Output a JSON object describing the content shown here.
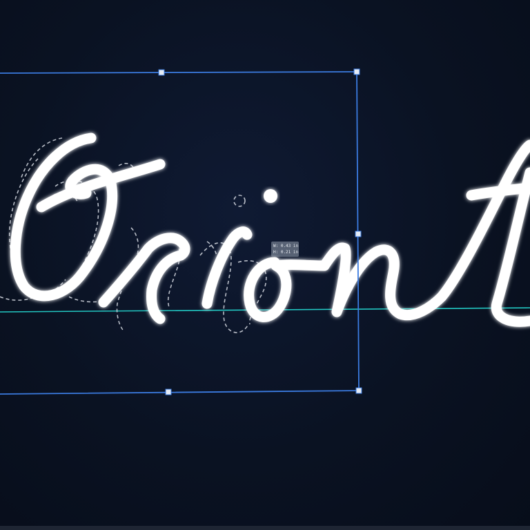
{
  "canvas": {
    "word": "Oriont",
    "colors": {
      "background": "#0b1324",
      "stroke_glow": "#ffffff",
      "outline_dashed": "#d7dbe3",
      "selection_box": "#3b7be0",
      "baseline_guide": "#22c7c2"
    }
  },
  "dimension_tooltip": {
    "width_label": "W: 0.43 in",
    "height_label": "H: 0.21 in"
  }
}
